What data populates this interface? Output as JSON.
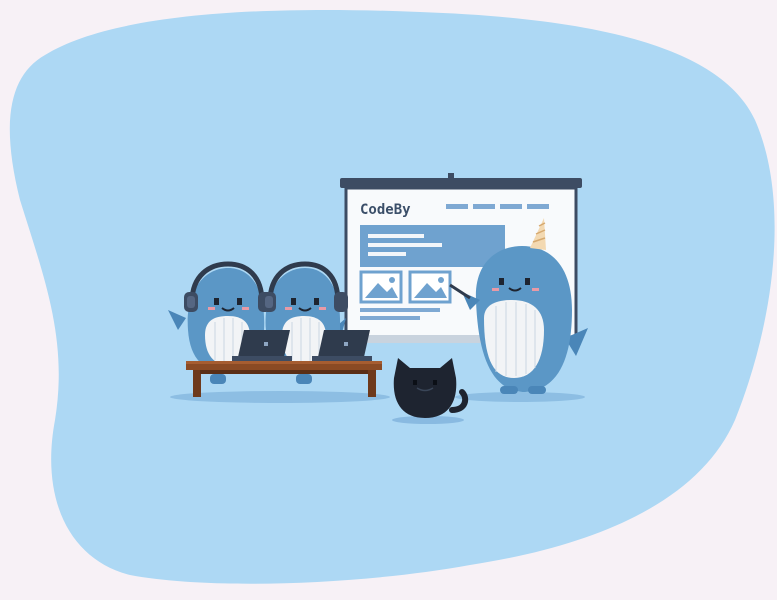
{
  "scene": {
    "presentation_screen": {
      "brand_text": "CodeBy"
    }
  },
  "colors": {
    "page_bg": "#f7f1f6",
    "blob": "#add8f4",
    "whale_body": "#5b97c6",
    "whale_belly": "#f2f4f6",
    "table_wood": "#8a4a24",
    "laptop": "#2f3b4d",
    "screen_panel": "#6fa2cf",
    "cat": "#1e2430"
  },
  "icons": [
    "headphones-icon",
    "laptop-icon",
    "image-placeholder-icon",
    "pointer-stick-icon"
  ]
}
